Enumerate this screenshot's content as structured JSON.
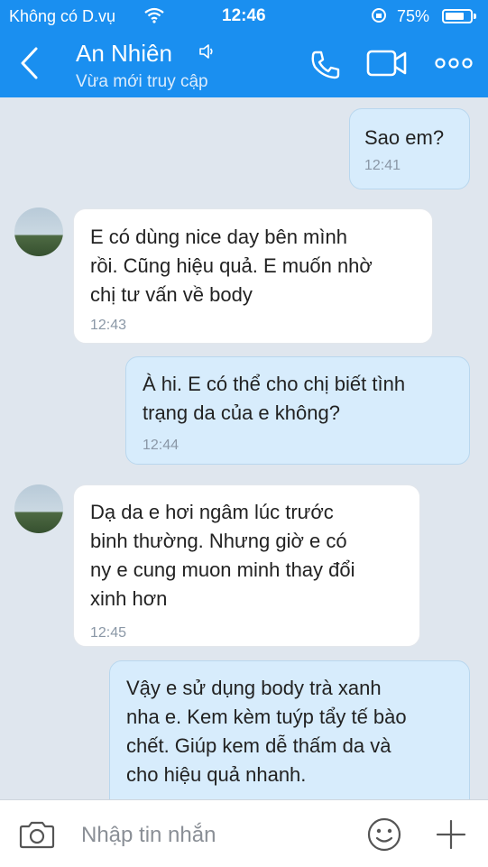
{
  "status_bar": {
    "carrier": "Không có D.vụ",
    "time": "12:46",
    "battery": "75%",
    "battery_level": 0.75
  },
  "header": {
    "contact_name": "An Nhiên",
    "status": "Vừa mới truy cập"
  },
  "messages": [
    {
      "direction": "sent",
      "text": "Sao em?",
      "time": "12:41"
    },
    {
      "direction": "received",
      "text": "E có dùng nice day bên mình\nrồi. Cũng hiệu quả. E muốn nhờ\nchị tư vấn về body",
      "time": "12:43"
    },
    {
      "direction": "sent",
      "text": "À hi. E có thể cho chị biết tình\ntrạng da của e không?",
      "time": "12:44"
    },
    {
      "direction": "received",
      "text": "Dạ da e hơi ngâm lúc trước\nbinh thường. Nhưng giờ e có\nny e cung muon minh thay đổi\nxinh hơn",
      "time": "12:45"
    },
    {
      "direction": "sent",
      "text": "Vậy e sử dụng body trà xanh\nnha e. Kem kèm tuýp tẩy tế bào\nchết. Giúp kem dễ thấm da và\ncho hiệu quả nhanh.",
      "time": ""
    }
  ],
  "composer": {
    "placeholder": "Nhập tin nhắn"
  },
  "icons": {
    "back": "chevron-left-icon",
    "speaker": "speaker-icon",
    "call": "phone-icon",
    "video": "video-camera-icon",
    "more": "more-icon",
    "camera": "camera-icon",
    "emoji": "emoji-icon",
    "add": "plus-icon"
  },
  "colors": {
    "header": "#1a8ff0",
    "sent_bubble": "#d7ecfc",
    "received_bubble": "#ffffff",
    "background": "#dfe6ee"
  }
}
